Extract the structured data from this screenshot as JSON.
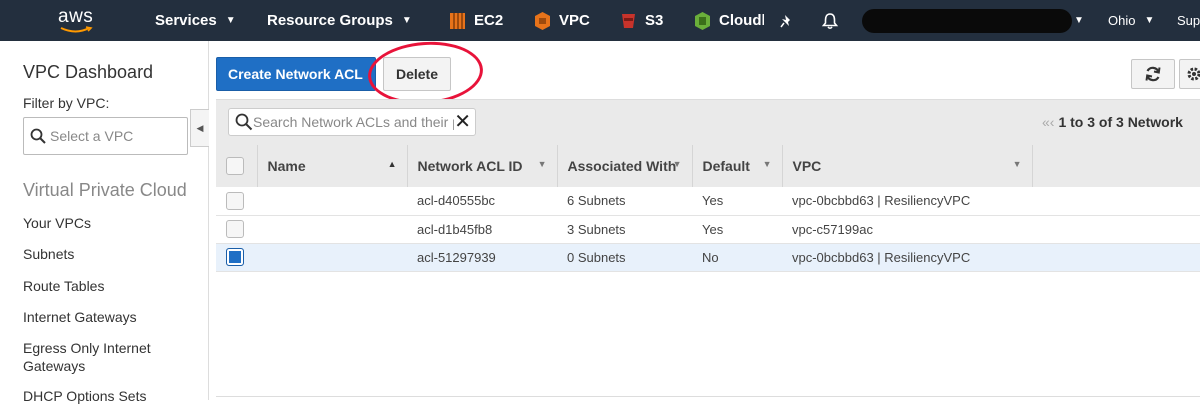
{
  "nav": {
    "logo": "aws",
    "services": "Services",
    "resource_groups": "Resource Groups",
    "shortcuts": [
      {
        "label": "EC2",
        "color": "#e7731a"
      },
      {
        "label": "VPC",
        "color": "#e7731a"
      },
      {
        "label": "S3",
        "color": "#c7332b"
      },
      {
        "label": "Cloudl",
        "color": "#6aaf3a"
      }
    ],
    "region": "Ohio",
    "support": "Sup"
  },
  "sidebar": {
    "title": "VPC Dashboard",
    "filter_label": "Filter by VPC:",
    "filter_placeholder": "Select a VPC",
    "section": "Virtual Private Cloud",
    "links": [
      "Your VPCs",
      "Subnets",
      "Route Tables",
      "Internet Gateways",
      "Egress Only Internet Gateways",
      "DHCP Options Sets"
    ]
  },
  "toolbar": {
    "create_label": "Create Network ACL",
    "delete_label": "Delete"
  },
  "search": {
    "placeholder": "Search Network ACLs and their proper",
    "pagination": "1 to 3 of 3 Network"
  },
  "table": {
    "columns": [
      "Name",
      "Network ACL ID",
      "Associated With",
      "Default",
      "VPC"
    ],
    "rows": [
      {
        "name": "",
        "id": "acl-d40555bc",
        "assoc": "6 Subnets",
        "default": "Yes",
        "vpc": "vpc-0bcbbd63 | ResiliencyVPC",
        "selected": false
      },
      {
        "name": "",
        "id": "acl-d1b45fb8",
        "assoc": "3 Subnets",
        "default": "Yes",
        "vpc": "vpc-c57199ac",
        "selected": false
      },
      {
        "name": "",
        "id": "acl-51297939",
        "assoc": "0 Subnets",
        "default": "No",
        "vpc": "vpc-0bcbbd63 | ResiliencyVPC",
        "selected": true
      }
    ]
  }
}
